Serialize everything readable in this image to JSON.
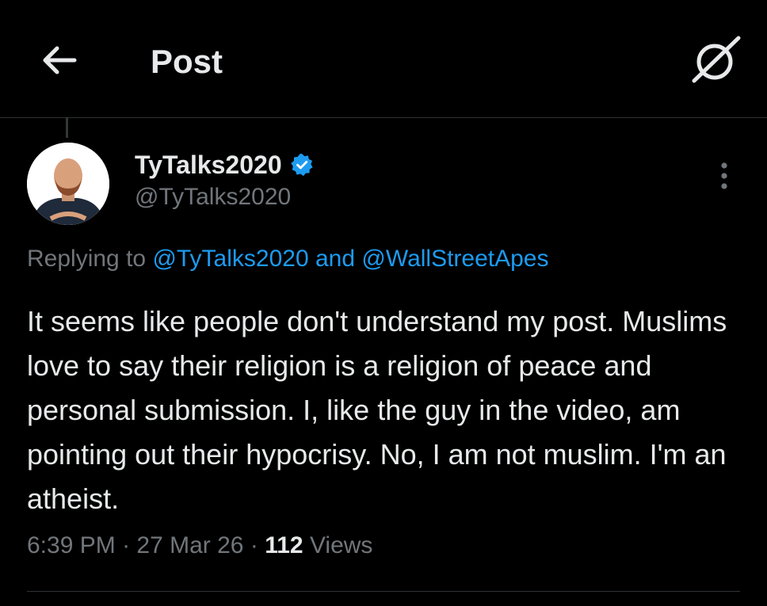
{
  "header": {
    "title": "Post",
    "back_icon": "arrow-left-icon",
    "grok_icon": "grok-icon"
  },
  "post": {
    "author": {
      "display_name": "TyTalks2020",
      "handle": "@TyTalks2020",
      "verified": true,
      "verified_icon": "verified-badge-icon",
      "verified_color": "#1d9bf0"
    },
    "replying_to": {
      "prefix": "Replying to",
      "mention1": "@TyTalks2020",
      "conjunction": "and",
      "mention2": "@WallStreetApes"
    },
    "text": "It seems like people don't understand my post. Muslims love to say their religion is a religion of peace and personal submission. I, like the guy in the video, am pointing out their hypocrisy. No, I am not muslim. I'm an atheist.",
    "time": "6:39 PM",
    "date": "27 Mar 26",
    "separator": "·",
    "views_count": "112",
    "views_label": "Views",
    "more_icon": "more-vertical-icon"
  },
  "colors": {
    "background": "#000000",
    "text": "#e7e9ea",
    "secondary": "#71767b",
    "accent": "#1d9bf0",
    "border": "#2f3336"
  }
}
